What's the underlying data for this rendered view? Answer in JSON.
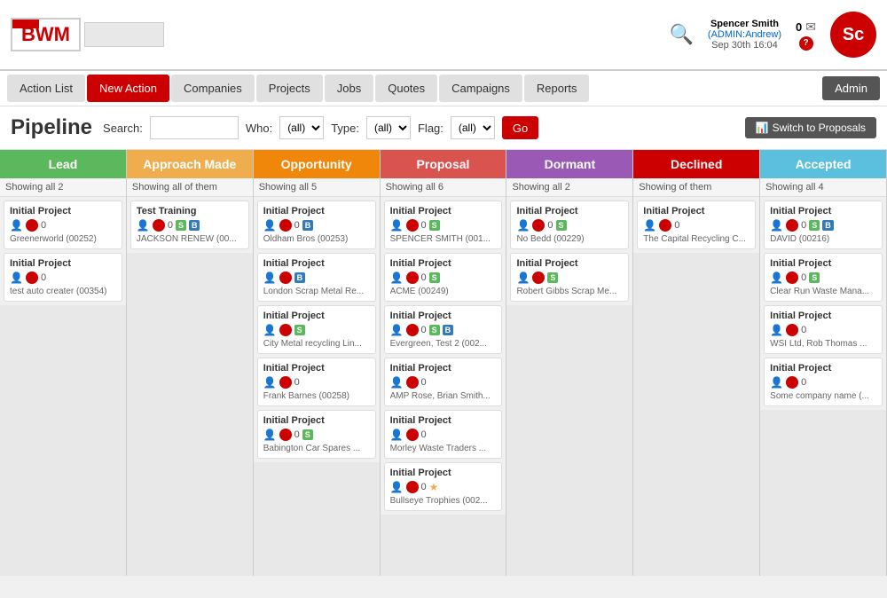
{
  "header": {
    "logo_text": "BWM",
    "user_name": "Spencer Smith",
    "user_admin": "(ADMIN:Andrew)",
    "user_date": "Sep 30th 16:04",
    "notif_count": "0",
    "sc_initials": "Sc"
  },
  "nav": {
    "items": [
      {
        "label": "Action List",
        "id": "action-list",
        "active": false
      },
      {
        "label": "New Action",
        "id": "new-action",
        "active": true
      },
      {
        "label": "Companies",
        "id": "companies",
        "active": false
      },
      {
        "label": "Projects",
        "id": "projects",
        "active": false
      },
      {
        "label": "Jobs",
        "id": "jobs",
        "active": false
      },
      {
        "label": "Quotes",
        "id": "quotes",
        "active": false
      },
      {
        "label": "Campaigns",
        "id": "campaigns",
        "active": false
      },
      {
        "label": "Reports",
        "id": "reports",
        "active": false
      }
    ],
    "admin_label": "Admin"
  },
  "pipeline": {
    "title": "Pipeline",
    "search_label": "Search:",
    "search_value": "",
    "who_label": "Who:",
    "who_default": "(all)",
    "type_label": "Type:",
    "type_default": "(all)",
    "flag_label": "Flag:",
    "flag_default": "(all)",
    "go_label": "Go",
    "switch_label": "Switch to Proposals"
  },
  "columns": [
    {
      "id": "lead",
      "label": "Lead",
      "color_class": "lead",
      "showing": "Showing all 2",
      "cards": [
        {
          "title": "Initial Project",
          "icons": [
            "person",
            "red-circle",
            "zero"
          ],
          "company": "Greenerworld (00252)"
        },
        {
          "title": "Initial Project",
          "icons": [
            "person",
            "red-circle",
            "zero"
          ],
          "company": "test auto creater (00354)"
        }
      ]
    },
    {
      "id": "approach",
      "label": "Approach Made",
      "color_class": "approach",
      "showing": "Showing all of them",
      "cards": [
        {
          "title": "Test Training",
          "icons": [
            "person",
            "red-circle",
            "zero",
            "badge-s",
            "badge-b"
          ],
          "company": "JACKSON RENEW (00..."
        }
      ]
    },
    {
      "id": "opportunity",
      "label": "Opportunity",
      "color_class": "opportunity",
      "showing": "Showing all 5",
      "cards": [
        {
          "title": "Initial Project",
          "icons": [
            "person",
            "red-circle",
            "zero",
            "badge-b"
          ],
          "company": "Oldham Bros (00253)"
        },
        {
          "title": "Initial Project",
          "icons": [
            "person",
            "red-circle",
            "badge-b"
          ],
          "company": "London Scrap Metal Re..."
        },
        {
          "title": "Initial Project",
          "icons": [
            "person",
            "red-circle",
            "badge-s"
          ],
          "company": "City Metal recycling Lin..."
        },
        {
          "title": "Initial Project",
          "icons": [
            "person",
            "red-circle",
            "zero"
          ],
          "company": "Frank Barnes (00258)"
        },
        {
          "title": "Initial Project",
          "icons": [
            "person",
            "red-circle",
            "zero",
            "badge-s"
          ],
          "company": "Babington Car Spares ..."
        }
      ]
    },
    {
      "id": "proposal",
      "label": "Proposal",
      "color_class": "proposal",
      "showing": "Showing all 6",
      "cards": [
        {
          "title": "Initial Project",
          "icons": [
            "person",
            "red-circle",
            "zero",
            "badge-s"
          ],
          "company": "SPENCER SMITH (001..."
        },
        {
          "title": "Initial Project",
          "icons": [
            "person",
            "red-circle",
            "zero",
            "badge-s"
          ],
          "company": "ACME (00249)"
        },
        {
          "title": "Initial Project",
          "icons": [
            "person",
            "red-circle",
            "zero",
            "badge-s",
            "badge-b"
          ],
          "company": "Evergreen, Test 2 (002..."
        },
        {
          "title": "Initial Project",
          "icons": [
            "person",
            "red-circle",
            "zero"
          ],
          "company": "AMP Rose, Brian Smith..."
        },
        {
          "title": "Initial Project",
          "icons": [
            "person",
            "red-circle",
            "zero"
          ],
          "company": "Morley Waste Traders ..."
        },
        {
          "title": "Initial Project",
          "icons": [
            "person",
            "red-circle",
            "zero",
            "star"
          ],
          "company": "Bullseye Trophies (002..."
        }
      ]
    },
    {
      "id": "dormant",
      "label": "Dormant",
      "color_class": "dormant",
      "showing": "Showing all 2",
      "cards": [
        {
          "title": "Initial Project",
          "icons": [
            "person",
            "red-circle",
            "zero",
            "badge-s"
          ],
          "company": "No Bedd (00229)"
        },
        {
          "title": "Initial Project",
          "icons": [
            "person",
            "red-circle",
            "badge-s"
          ],
          "company": "Robert Gibbs Scrap Me..."
        }
      ]
    },
    {
      "id": "declined",
      "label": "Declined",
      "color_class": "declined",
      "showing": "Showing of them",
      "cards": [
        {
          "title": "Initial Project",
          "icons": [
            "person",
            "red-circle",
            "zero"
          ],
          "company": "The Capital Recycling C..."
        }
      ]
    },
    {
      "id": "accepted",
      "label": "Accepted",
      "color_class": "accepted",
      "showing": "Showing all 4",
      "cards": [
        {
          "title": "Initial Project",
          "icons": [
            "person",
            "red-circle",
            "zero",
            "badge-s",
            "badge-b"
          ],
          "company": "DAVID (00216)"
        },
        {
          "title": "Initial Project",
          "icons": [
            "person",
            "red-circle",
            "zero",
            "badge-s"
          ],
          "company": "Clear Run Waste Mana..."
        },
        {
          "title": "Initial Project",
          "icons": [
            "person",
            "red-circle",
            "zero"
          ],
          "company": "WSI Ltd, Rob Thomas ..."
        },
        {
          "title": "Initial Project",
          "icons": [
            "person",
            "red-circle",
            "zero"
          ],
          "company": "Some company name (..."
        }
      ]
    }
  ]
}
